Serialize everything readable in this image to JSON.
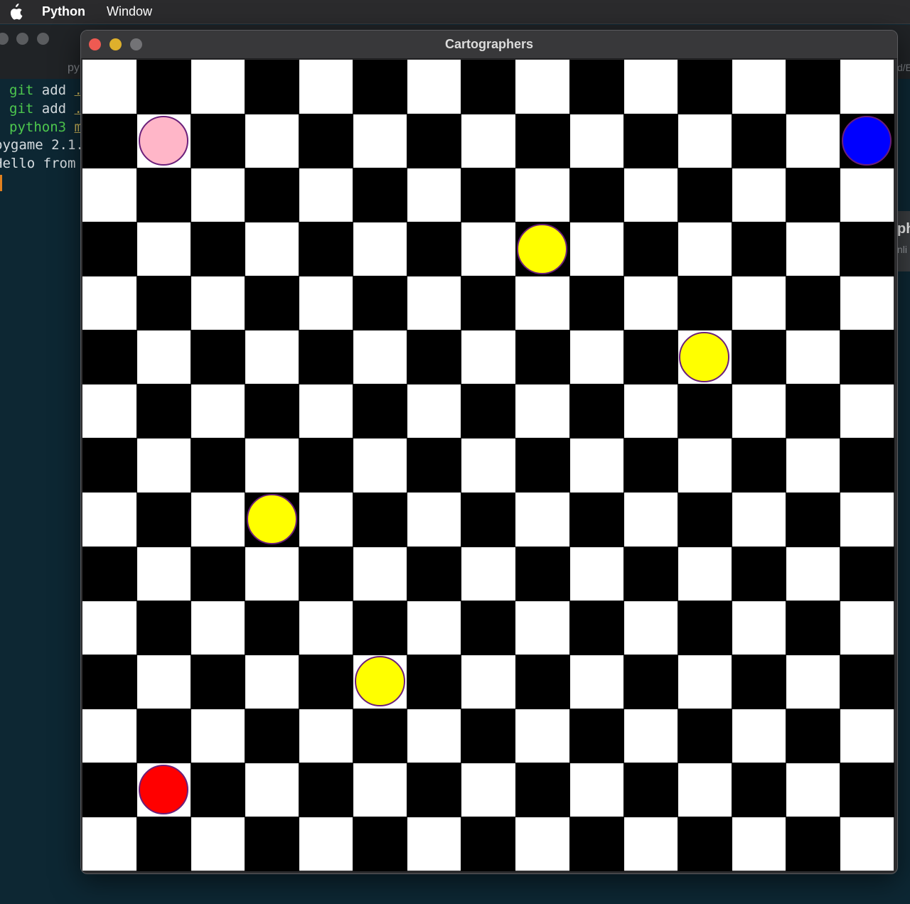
{
  "menubar": {
    "apple_icon": "apple-logo-icon",
    "app_name": "Python",
    "window_menu": "Window"
  },
  "terminal": {
    "tab_title": "py",
    "right_label": "d/E",
    "lines": [
      {
        "cmd": "git",
        "arg": " add ",
        "path": "."
      },
      {
        "cmd": "git",
        "arg": " add ",
        "path": "."
      },
      {
        "cmd": "python3",
        "arg": " ",
        "path": "m"
      }
    ],
    "output": [
      "pygame 2.1.",
      "Hello from "
    ]
  },
  "side_panel": {
    "title": "ph",
    "subtitle": "nli"
  },
  "game_window": {
    "title": "Cartographers",
    "board": {
      "rows": 15,
      "cols": 15,
      "light_color": "#ffffff",
      "dark_color": "#000000",
      "outline_color": "#6b1f7a",
      "pieces": [
        {
          "name": "pink-piece",
          "color": "#ffb6c8",
          "row": 1,
          "col": 1
        },
        {
          "name": "blue-piece",
          "color": "#0000ff",
          "row": 1,
          "col": 14
        },
        {
          "name": "yellow-piece",
          "color": "#ffff00",
          "row": 3,
          "col": 8
        },
        {
          "name": "yellow-piece",
          "color": "#ffff00",
          "row": 5,
          "col": 11
        },
        {
          "name": "yellow-piece",
          "color": "#ffff00",
          "row": 8,
          "col": 3
        },
        {
          "name": "yellow-piece",
          "color": "#ffff00",
          "row": 11,
          "col": 5
        },
        {
          "name": "red-piece",
          "color": "#ff0000",
          "row": 13,
          "col": 1
        }
      ]
    }
  }
}
